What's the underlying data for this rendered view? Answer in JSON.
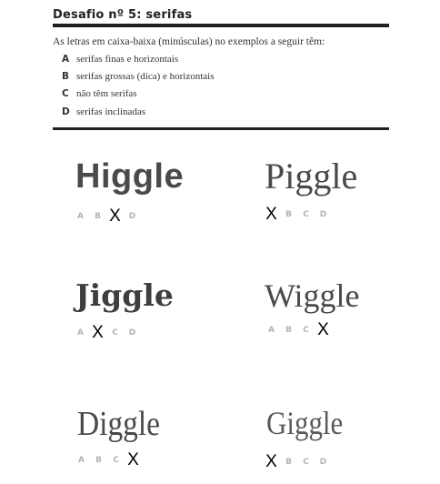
{
  "header": {
    "title": "Desafio nº 5: serifas",
    "intro": "As letras em caixa-baixa (minúsculas) no exemplos a seguir têm:"
  },
  "options": [
    {
      "letter": "A",
      "text": "serifas finas e horizontais"
    },
    {
      "letter": "B",
      "text": "serifas grossas (dica) e horizontais"
    },
    {
      "letter": "C",
      "text": "não têm serifas"
    },
    {
      "letter": "D",
      "text": "serifas inclinadas"
    }
  ],
  "mark_symbol": "X",
  "examples": [
    {
      "word": "Higgle",
      "answers": [
        "A",
        "B",
        "X",
        "D"
      ]
    },
    {
      "word": "Piggle",
      "answers": [
        "X",
        "B",
        "C",
        "D"
      ]
    },
    {
      "word": "Jiggle",
      "answers": [
        "A",
        "X",
        "C",
        "D"
      ]
    },
    {
      "word": "Wiggle",
      "answers": [
        "A",
        "B",
        "C",
        "X"
      ]
    },
    {
      "word": "Diggle",
      "answers": [
        "A",
        "B",
        "C",
        "X"
      ]
    },
    {
      "word": "Giggle",
      "answers": [
        "X",
        "B",
        "C",
        "D"
      ]
    }
  ]
}
